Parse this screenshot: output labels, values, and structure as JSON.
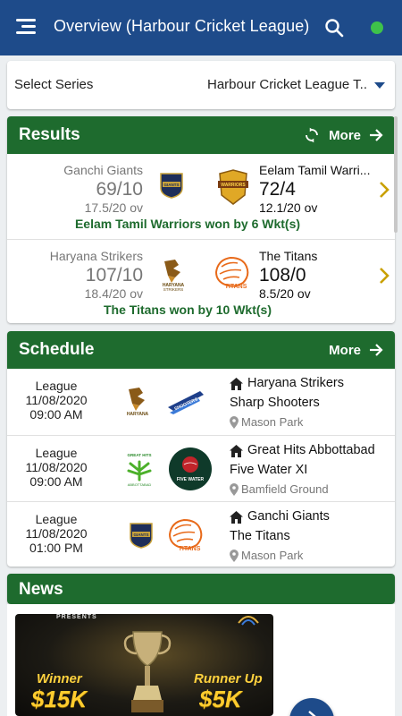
{
  "appbar": {
    "title": "Overview (Harbour Cricket League)",
    "status_color": "#3ec24a"
  },
  "series": {
    "label": "Select Series",
    "value": "Harbour Cricket League T..."
  },
  "results": {
    "title": "Results",
    "more": "More",
    "matches": [
      {
        "team_a": "Ganchi Giants",
        "score_a": "69/10",
        "overs_a": "17.5/20 ov",
        "logo_a": "ganchi-giants-logo",
        "team_b": "Eelam Tamil Warri...",
        "score_b": "72/4",
        "overs_b": "12.1/20 ov",
        "logo_b": "eelam-tamil-warriors-logo",
        "result": "Eelam Tamil Warriors won by 6 Wkt(s)"
      },
      {
        "team_a": "Haryana Strikers",
        "score_a": "107/10",
        "overs_a": "18.4/20 ov",
        "logo_a": "haryana-strikers-logo",
        "team_b": "The Titans",
        "score_b": "108/0",
        "overs_b": "8.5/20 ov",
        "logo_b": "the-titans-logo",
        "result": "The Titans won by 10 Wkt(s)"
      }
    ]
  },
  "schedule": {
    "title": "Schedule",
    "more": "More",
    "rows": [
      {
        "type": "League",
        "date": "11/08/2020",
        "time": "09:00 AM",
        "team_home": "Haryana Strikers",
        "team_away": "Sharp Shooters",
        "venue": "Mason Park"
      },
      {
        "type": "League",
        "date": "11/08/2020",
        "time": "09:00 AM",
        "team_home": "Great Hits Abbottabad",
        "team_away": "Five Water XI",
        "venue": "Bamfield Ground"
      },
      {
        "type": "League",
        "date": "11/08/2020",
        "time": "01:00 PM",
        "team_home": "Ganchi Giants",
        "team_away": "The Titans",
        "venue": "Mason Park"
      }
    ]
  },
  "news": {
    "title": "News",
    "banner": {
      "presents": "PRESENTS",
      "winner_label": "Winner",
      "winner_amount": "$15K",
      "runner_label": "Runner Up",
      "runner_amount": "$5K"
    }
  }
}
